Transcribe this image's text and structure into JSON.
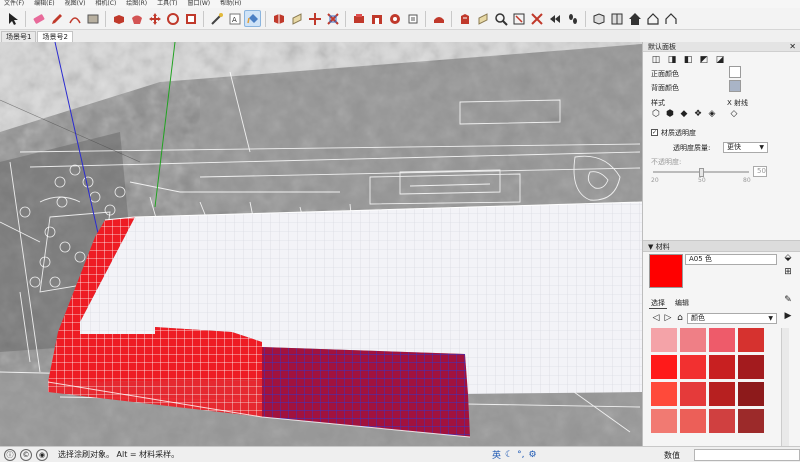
{
  "menu": [
    "文件(F)",
    "编辑(E)",
    "视图(V)",
    "相机(C)",
    "绘图(R)",
    "工具(T)",
    "窗口(W)",
    "帮助(H)"
  ],
  "toolbar_icons": [
    "select-arrow-icon",
    "eraser-icon",
    "pencil-icon",
    "arc-icon",
    "rectangle-icon",
    "push-pull-icon",
    "follow-me-icon",
    "move-icon",
    "rotate-icon",
    "scale-icon",
    "tape-measure-icon",
    "text-icon",
    "paint-bucket-icon",
    "orbit-icon",
    "pan-icon",
    "zoom-icon",
    "zoom-extents-icon",
    "component-icon",
    "warehouse-icon",
    "extension-icon",
    "section-icon",
    "walk-icon",
    "look-around-icon",
    "position-camera-icon",
    "zoom-window-icon",
    "previous-view-icon",
    "footprints-icon",
    "iso-view-icon",
    "front-view-icon",
    "home-icon",
    "house-icon",
    "house-outline-icon"
  ],
  "scene_tabs": [
    "场景号1",
    "场景号2"
  ],
  "panel": {
    "title": "默认面板",
    "front_color_label": "正面颜色",
    "back_color_label": "背面颜色",
    "style_label": "样式",
    "xray_label": "X 射线",
    "material_transparency_label": "材质透明度",
    "transparency_quality_label": "透明度质量:",
    "transparency_quality_value": "更快",
    "opacity_label": "不透明度:",
    "opacity_value": "50",
    "slider_ticks": [
      "20",
      "50",
      "80"
    ],
    "materials_header": "材料",
    "material_name": "A05 色",
    "tab_select": "选择",
    "tab_edit": "编辑",
    "library_value": "颜色",
    "palette": [
      "#f4a3a8",
      "#ef7f86",
      "#ee5b6a",
      "#d6322f",
      "#ff1a1a",
      "#f23030",
      "#c82021",
      "#a31b1e",
      "#ff4a3a",
      "#e53a3a",
      "#b72020",
      "#8d1a1b",
      "#f17a72",
      "#ec5f58",
      "#d04040",
      "#9c2a2a"
    ]
  },
  "status": {
    "text": "选择涂刷对象。 Alt = 材料采样。",
    "ime": "英",
    "measure_label": "数值"
  },
  "colors": {
    "material_swatch": "#ff0000",
    "front_color": "#ffffff",
    "back_color": "#a9b4c6",
    "red_mesh": "#ee1c24",
    "purple_mesh": "#a1123e"
  }
}
